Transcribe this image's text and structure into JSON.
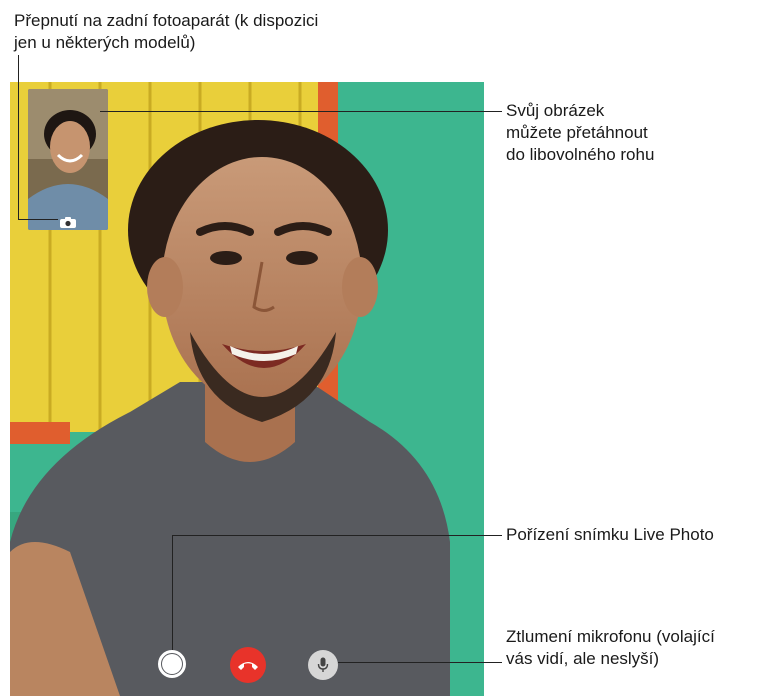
{
  "callouts": {
    "flip_camera": "Přepnutí na zadní fotoaparát (k dispozici\njen u některých modelů)",
    "drag_pip": "Svůj obrázek\nmůžete přetáhnout\ndo libovolného rohu",
    "live_photo": "Pořízení snímku Live Photo",
    "mute": "Ztlumení mikrofonu (volající\nvás vidí, ale neslyší)"
  },
  "icons": {
    "flip": "camera-flip-icon",
    "shutter": "live-photo-shutter-icon",
    "end": "phone-hangup-icon",
    "mute": "microphone-icon"
  },
  "colors": {
    "end_call": "#e8332a",
    "mute_bg": "#d6d6d6",
    "wall_yellow": "#e9cf3a",
    "wall_green": "#3db68f"
  }
}
